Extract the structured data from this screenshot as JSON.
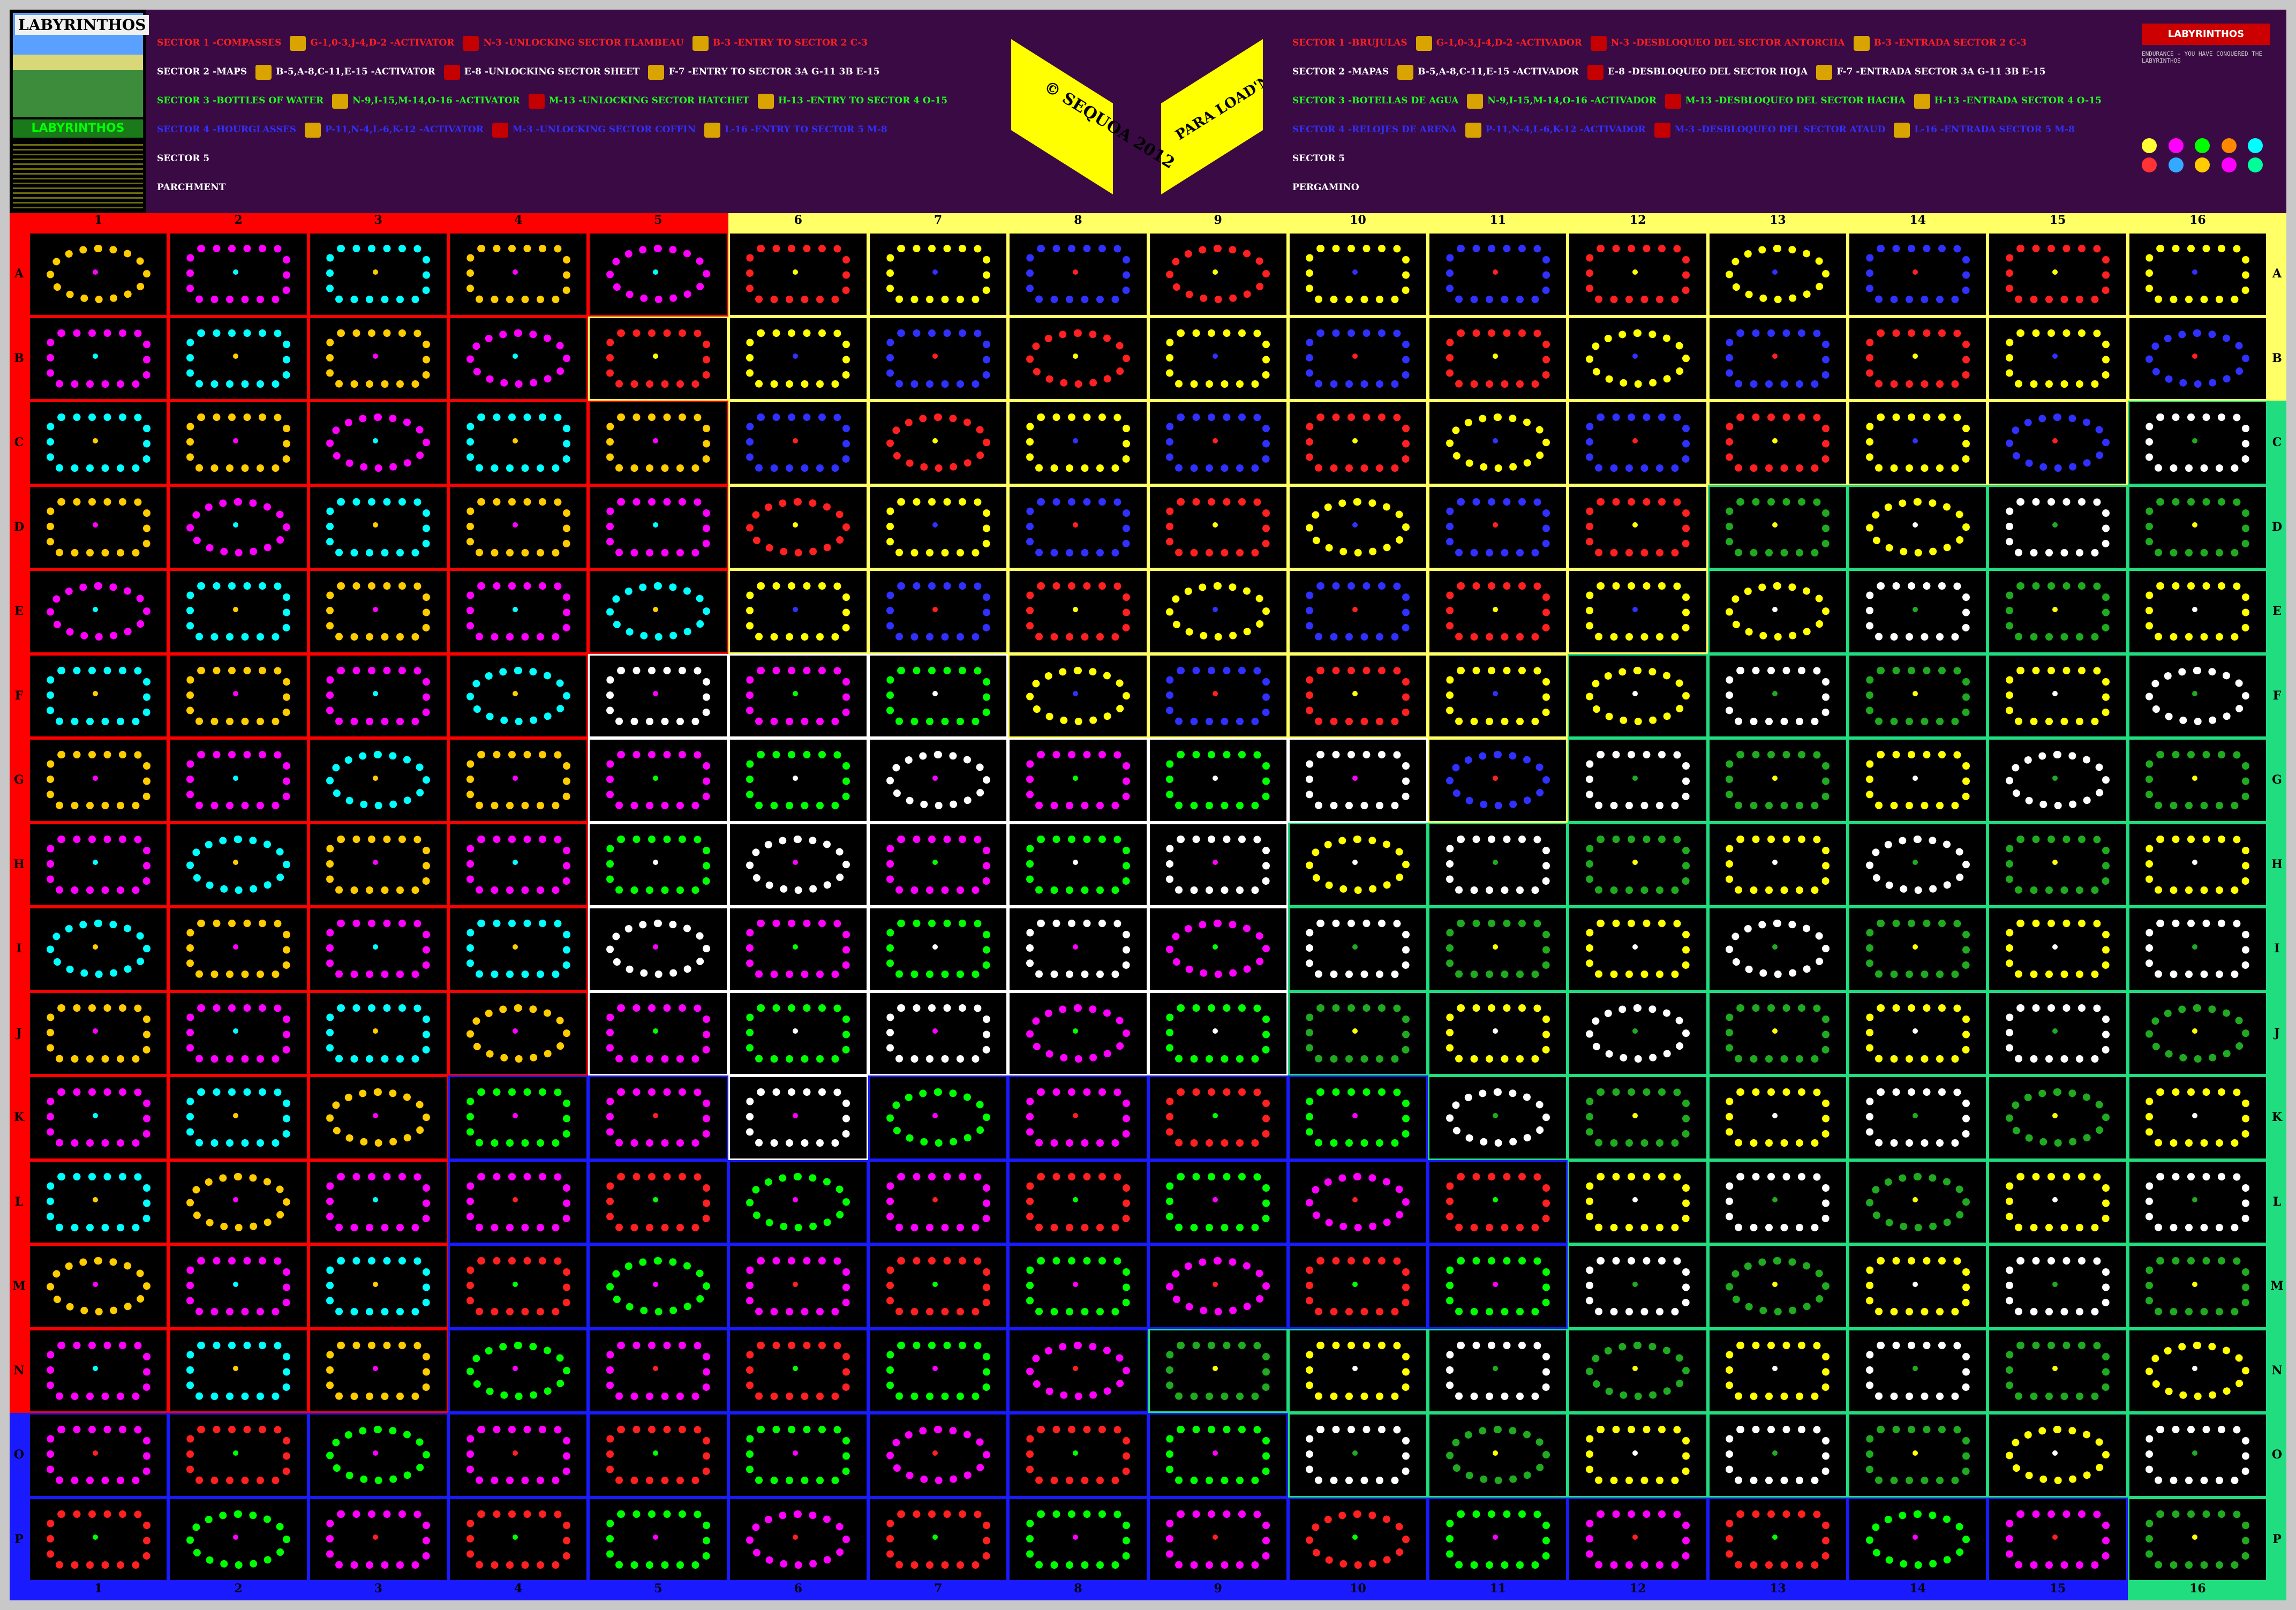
{
  "logo": {
    "title": "LABYRINTHOS",
    "subtitle": "LABYRINTHOS"
  },
  "legend_en": [
    {
      "label": "SECTOR 1 -COMPASSES",
      "items": "G-1,0-3,J-4,D-2 -ACTIVATOR",
      "extra": "N-3 -UNLOCKING SECTOR FLAMBEAU",
      "extra2": "B-3 -ENTRY TO SECTOR 2 C-3",
      "color": "#ff2020"
    },
    {
      "label": "SECTOR 2 -MAPS",
      "items": "B-5,A-8,C-11,E-15 -ACTIVATOR",
      "extra": "E-8 -UNLOCKING SECTOR SHEET",
      "extra2": "F-7 -ENTRY TO SECTOR 3A G-11 3B E-15",
      "color": "#ffffff"
    },
    {
      "label": "SECTOR 3 -BOTTLES OF WATER",
      "items": "N-9,I-15,M-14,O-16 -ACTIVATOR",
      "extra": "M-13 -UNLOCKING SECTOR HATCHET",
      "extra2": "H-13 -ENTRY TO SECTOR 4 O-15",
      "color": "#20ff20"
    },
    {
      "label": "SECTOR 4 -HOURGLASSES",
      "items": "P-11,N-4,L-6,K-12 -ACTIVATOR",
      "extra": "M-3 -UNLOCKING SECTOR COFFIN",
      "extra2": "L-16 -ENTRY TO SECTOR 5 M-8",
      "color": "#3030ff"
    },
    {
      "label": "SECTOR 5",
      "items": "",
      "extra": "",
      "extra2": "",
      "color": "#ffffff"
    },
    {
      "label": "PARCHMENT",
      "items": "",
      "extra": "",
      "extra2": "",
      "color": "#ffffff"
    }
  ],
  "legend_es": [
    {
      "label": "SECTOR 1 -BRUJULAS",
      "items": "G-1,0-3,J-4,D-2 -ACTIVADOR",
      "extra": "N-3 -DESBLOQUEO DEL SECTOR ANTORCHA",
      "extra2": "B-3 -ENTRADA SECTOR 2 C-3",
      "color": "#ff2020"
    },
    {
      "label": "SECTOR 2 -MAPAS",
      "items": "B-5,A-8,C-11,E-15 -ACTIVADOR",
      "extra": "E-8 -DESBLOQUEO DEL SECTOR HOJA",
      "extra2": "F-7 -ENTRADA SECTOR 3A G-11 3B E-15",
      "color": "#ffffff"
    },
    {
      "label": "SECTOR 3 -BOTELLAS DE AGUA",
      "items": "N-9,I-15,M-14,O-16 -ACTIVADOR",
      "extra": "M-13 -DESBLOQUEO DEL SECTOR HACHA",
      "extra2": "H-13 -ENTRADA SECTOR 4 O-15",
      "color": "#20ff20"
    },
    {
      "label": "SECTOR 4 -RELOJES DE ARENA",
      "items": "P-11,N-4,L-6,K-12 -ACTIVADOR",
      "extra": "M-3 -DESBLOQUEO DEL SECTOR ATAUD",
      "extra2": "L-16 -ENTRADA SECTOR 5 M-8",
      "color": "#3030ff"
    },
    {
      "label": "SECTOR 5",
      "items": "",
      "extra": "",
      "extra2": "",
      "color": "#ffffff"
    },
    {
      "label": "PERGAMINO",
      "items": "",
      "extra": "",
      "extra2": "",
      "color": "#ffffff"
    }
  ],
  "copyright": {
    "text": "© SEQUOA 2012",
    "para": "PARA LOAD'N'RUN"
  },
  "banner": {
    "title": "LABYRINTHOS",
    "meta": "ENDURANCE - YOU HAVE CONQUERED THE LABYRINTHOS"
  },
  "columns": [
    "1",
    "2",
    "3",
    "4",
    "5",
    "6",
    "7",
    "8",
    "9",
    "10",
    "11",
    "12",
    "13",
    "14",
    "15",
    "16"
  ],
  "rows": [
    "A",
    "B",
    "C",
    "D",
    "E",
    "F",
    "G",
    "H",
    "I",
    "J",
    "K",
    "L",
    "M",
    "N",
    "O",
    "P"
  ],
  "sector_colors": {
    "red": "#ff0000",
    "yellow": "#ffff66",
    "white": "#ffffff",
    "blue": "#1a1aff",
    "green": "#20dd80"
  },
  "sector_map": [
    "RRRRRYYYYYYYYYYY",
    "RRRRYYYYYYYYYYYY",
    "RRRRRYYYYYYYYYYG",
    "RRRRRYYYYYYYGGGG",
    "RRRRRYYYYYYYGGGG",
    "RRRRWWWYYYYGGGGG",
    "RRRRWWWWWWYGGGGG",
    "RRRRWWWWWGGGGGGG",
    "RRRRWWWWWGGGGGGG",
    "RRRRWWWWWGGGGGGG",
    "RRRBBWBBBBGGGGGG",
    "RRRBBBBBBBBGGGGG",
    "RRRBBBBBBBBGGGGG",
    "RRRBBBBBGGGGGGGG",
    "BBBBBBBBBGGGGGGG",
    "BBBBBBBBBBBBBBBG"
  ]
}
